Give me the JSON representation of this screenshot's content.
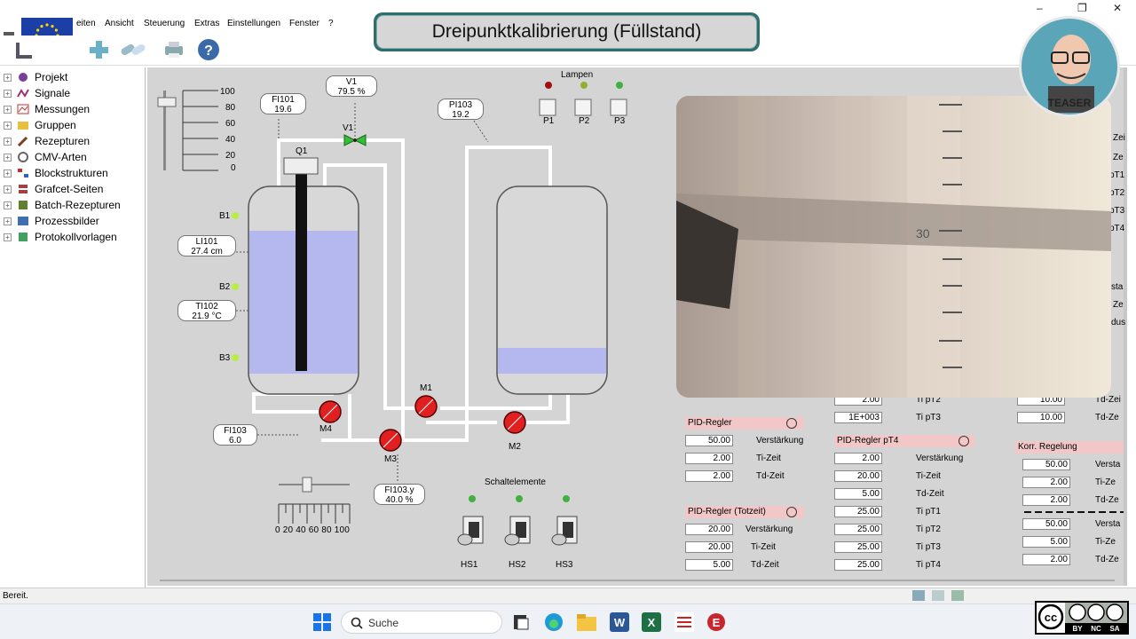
{
  "menu": {
    "items": [
      "eiten",
      "Ansicht",
      "Steuerung",
      "Extras",
      "Einstellungen",
      "Fenster",
      "?"
    ]
  },
  "window_controls": {
    "minimize": "–",
    "restore": "❐",
    "close": "✕"
  },
  "title_banner": "Dreipunktkalibrierung (Füllstand)",
  "sidebar": {
    "items": [
      {
        "label": "Projekt",
        "icon": "project-icon"
      },
      {
        "label": "Signale",
        "icon": "signals-icon"
      },
      {
        "label": "Messungen",
        "icon": "measurements-icon"
      },
      {
        "label": "Gruppen",
        "icon": "groups-icon"
      },
      {
        "label": "Rezepturen",
        "icon": "recipes-icon"
      },
      {
        "label": "CMV-Arten",
        "icon": "cmv-icon"
      },
      {
        "label": "Blockstrukturen",
        "icon": "block-structure-icon"
      },
      {
        "label": "Grafcet-Seiten",
        "icon": "grafcet-icon"
      },
      {
        "label": "Batch-Rezepturen",
        "icon": "batch-icon"
      },
      {
        "label": "Prozessbilder",
        "icon": "process-image-icon"
      },
      {
        "label": "Protokollvorlagen",
        "icon": "protocol-icon"
      }
    ]
  },
  "process": {
    "scale_top": [
      "100",
      "80",
      "60",
      "40",
      "20",
      "0"
    ],
    "scale_bottom": "0 20 40 60 80 100",
    "sensors": {
      "FI101": {
        "name": "FI101",
        "value": "19.6"
      },
      "V1": {
        "name": "V1",
        "value": "79.5 %"
      },
      "PI103": {
        "name": "PI103",
        "value": "19.2"
      },
      "LI101": {
        "name": "LI101",
        "value": "27.4 cm"
      },
      "TI102": {
        "name": "TI102",
        "value": "21.9 °C"
      },
      "FI103": {
        "name": "FI103",
        "value": "6.0"
      },
      "FI103y": {
        "name": "FI103.y",
        "value": "40.0 %"
      }
    },
    "labels": {
      "Q1": "Q1",
      "V1": "V1",
      "B1": "B1",
      "B2": "B2",
      "B3": "B3",
      "M1": "M1",
      "M2": "M2",
      "M3": "M3",
      "M4": "M4",
      "lamps": "Lampen",
      "P1": "P1",
      "P2": "P2",
      "P3": "P3",
      "switches": "Schaltelemente",
      "HS1": "HS1",
      "HS2": "HS2",
      "HS3": "HS3"
    },
    "tank1_level": 0.78,
    "tank2_level": 0.22,
    "valve_slider_level": 0.4
  },
  "pid_panels": {
    "col1": {
      "head1": "PID-Regler",
      "rows1": [
        {
          "value": "50.00",
          "label": "Verstärkung"
        },
        {
          "value": "2.00",
          "label": "Ti-Zeit"
        },
        {
          "value": "2.00",
          "label": "Td-Zeit"
        }
      ],
      "head2": "PID-Regler (Totzeit)",
      "rows2": [
        {
          "value": "20.00",
          "label": "Verstärkung"
        },
        {
          "value": "20.00",
          "label": "Ti-Zeit"
        },
        {
          "value": "5.00",
          "label": "Td-Zeit"
        }
      ]
    },
    "col2": {
      "top_rows": [
        {
          "value": "2.00",
          "label": "Ti pT2"
        },
        {
          "value": "1E+003",
          "label": "Ti pT3"
        }
      ],
      "head": "PID-Regler pT4",
      "rows": [
        {
          "value": "2.00",
          "label": "Verstärkung"
        },
        {
          "value": "20.00",
          "label": "Ti-Zeit"
        },
        {
          "value": "5.00",
          "label": "Td-Zeit"
        },
        {
          "value": "25.00",
          "label": "Ti pT1"
        },
        {
          "value": "25.00",
          "label": "Ti pT2"
        },
        {
          "value": "25.00",
          "label": "Ti pT3"
        },
        {
          "value": "25.00",
          "label": "Ti pT4"
        }
      ]
    },
    "col3": {
      "top_rows": [
        {
          "value": "10.00",
          "label": "Td-Zei"
        },
        {
          "value": "10.00",
          "label": "Td-Ze"
        }
      ],
      "head": "Korr. Regelung",
      "rows": [
        {
          "value": "50.00",
          "label": "Versta"
        },
        {
          "value": "2.00",
          "label": "Ti-Ze"
        },
        {
          "value": "2.00",
          "label": "Td-Ze"
        },
        {
          "value": "50.00",
          "label": "Versta"
        },
        {
          "value": "5.00",
          "label": "Ti-Ze"
        },
        {
          "value": "2.00",
          "label": "Td-Ze"
        }
      ],
      "edge_labels": [
        "Zei",
        "Ze",
        "pT1",
        "pT2",
        "pT3",
        "pT4",
        "sta",
        "Ze",
        "dus"
      ]
    }
  },
  "video_scale_label": "30",
  "teaser_label": "TEASER",
  "status": "Bereit.",
  "taskbar": {
    "search_placeholder": "Suche"
  },
  "cc_license": {
    "by": "BY",
    "nc": "NC",
    "sa": "SA"
  }
}
